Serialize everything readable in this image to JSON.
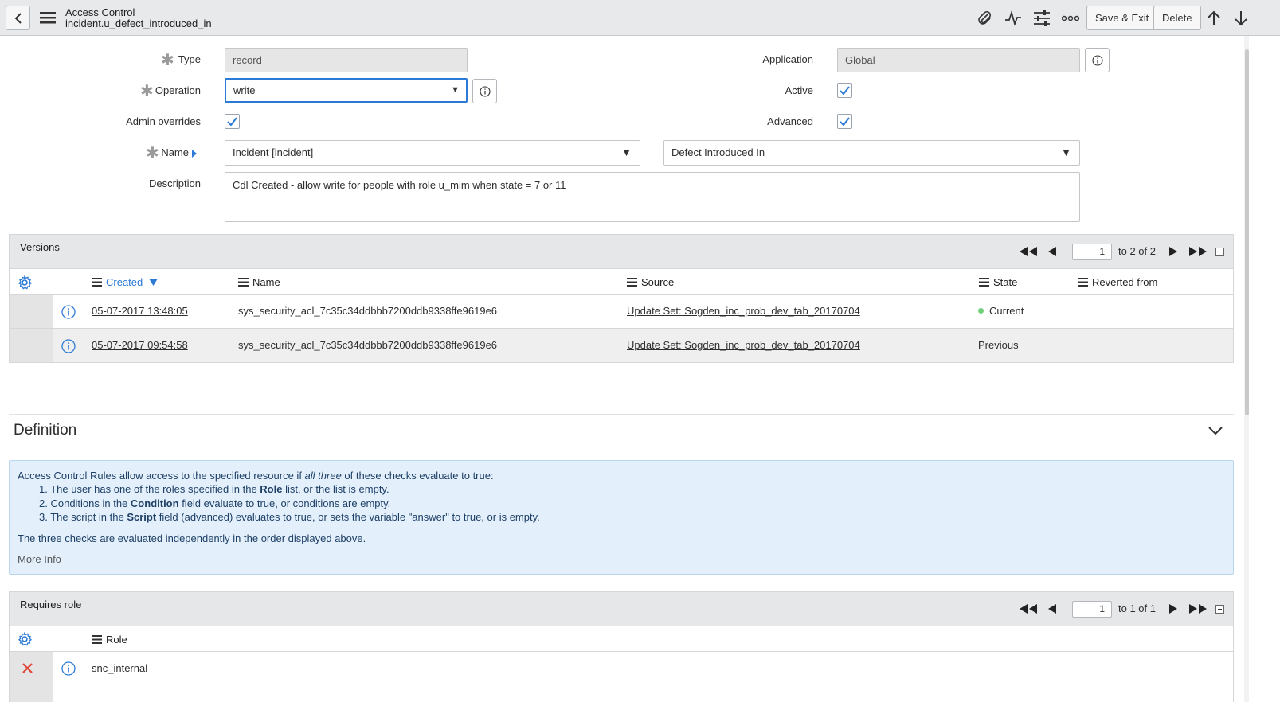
{
  "header": {
    "title": "Access Control",
    "subtitle": "incident.u_defect_introduced_in",
    "save_exit_label": "Save & Exit",
    "delete_label": "Delete"
  },
  "form": {
    "type_label": "Type",
    "type_value": "record",
    "operation_label": "Operation",
    "operation_value": "write",
    "admin_overrides_label": "Admin overrides",
    "admin_overrides_checked": true,
    "name_label": "Name",
    "name_table_value": "Incident [incident]",
    "name_field_value": "Defect Introduced In",
    "description_label": "Description",
    "description_value": "Cdl Created - allow write for people with role u_mim when state = 7 or 11",
    "application_label": "Application",
    "application_value": "Global",
    "active_label": "Active",
    "active_checked": true,
    "advanced_label": "Advanced",
    "advanced_checked": true
  },
  "versions": {
    "title": "Versions",
    "page_value": "1",
    "page_text": "to 2 of 2",
    "columns": {
      "created": "Created",
      "name": "Name",
      "source": "Source",
      "state": "State",
      "reverted_from": "Reverted from"
    },
    "rows": [
      {
        "created": "05-07-2017 13:48:05",
        "name": "sys_security_acl_7c35c34ddbbb7200ddb9338ffe9619e6",
        "source": "Update Set: Sogden_inc_prob_dev_tab_20170704",
        "state": "Current"
      },
      {
        "created": "05-07-2017 09:54:58",
        "name": "sys_security_acl_7c35c34ddbbb7200ddb9338ffe9619e6",
        "source": "Update Set: Sogden_inc_prob_dev_tab_20170704",
        "state": "Previous"
      }
    ]
  },
  "definition": {
    "title": "Definition",
    "intro_before": "Access Control Rules allow access to the specified resource if ",
    "intro_em": "all three",
    "intro_after": " of these checks evaluate to true:",
    "items": [
      {
        "num": "1.",
        "before": "The user has one of the roles specified in the ",
        "bold": "Role",
        "after": " list, or the list is empty."
      },
      {
        "num": "2.",
        "before": "Conditions in the ",
        "bold": "Condition",
        "after": " field evaluate to true, or conditions are empty."
      },
      {
        "num": "3.",
        "before": "The script in the ",
        "bold": "Script",
        "after": " field (advanced) evaluates to true, or sets the variable \"answer\" to true, or is empty."
      }
    ],
    "footer": "The three checks are evaluated independently in the order displayed above.",
    "more_info": "More Info"
  },
  "requires_role": {
    "title": "Requires role",
    "page_value": "1",
    "page_text": "to 1 of 1",
    "column_role": "Role",
    "rows": [
      {
        "role": "snc_internal"
      }
    ]
  },
  "colors": {
    "accent": "#2c7ad6",
    "header_bg": "#e8e9eb",
    "info_bg": "#e3f0fb",
    "current_dot": "#71d17a",
    "delete_x": "#e0463a"
  },
  "icons": [
    "back-icon",
    "menu-icon",
    "paperclip-icon",
    "activity-icon",
    "settings-sliders-icon",
    "more-icon",
    "arrow-up-icon",
    "arrow-down-icon",
    "info-icon",
    "gear-icon",
    "sort-down-icon",
    "chevron-down-icon",
    "delete-x-icon"
  ]
}
